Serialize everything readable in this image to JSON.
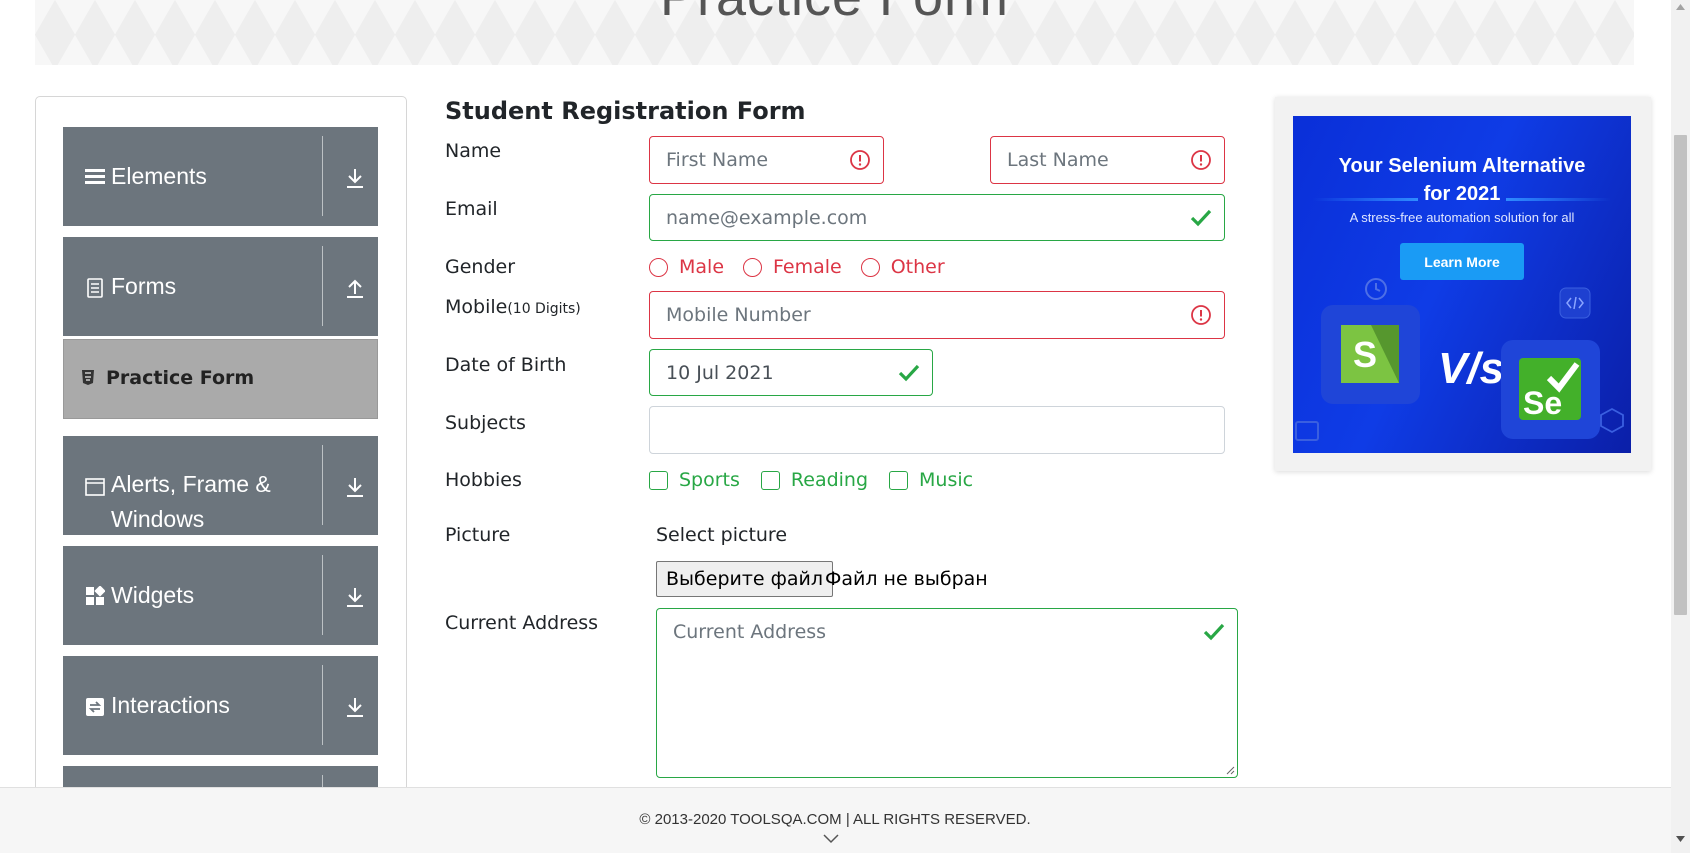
{
  "header": {
    "title": "Practice Form"
  },
  "sidebar": {
    "groups": [
      {
        "label": "Elements",
        "icon": "hamburger-icon",
        "arrow": "download-arrow-icon"
      },
      {
        "label": "Forms",
        "icon": "document-icon",
        "arrow": "upload-arrow-icon"
      },
      {
        "label": "Alerts, Frame & Windows",
        "icon": "window-icon",
        "arrow": "download-arrow-icon"
      },
      {
        "label": "Widgets",
        "icon": "widgets-icon",
        "arrow": "download-arrow-icon"
      },
      {
        "label": "Interactions",
        "icon": "interactions-icon",
        "arrow": "download-arrow-icon"
      }
    ],
    "active_item": {
      "label": "Practice Form",
      "icon": "html5-icon"
    }
  },
  "form": {
    "title": "Student Registration Form",
    "labels": {
      "name": "Name",
      "email": "Email",
      "gender": "Gender",
      "mobile": "Mobile",
      "mobile_hint": "(10 Digits)",
      "dob": "Date of Birth",
      "subjects": "Subjects",
      "hobbies": "Hobbies",
      "picture": "Picture",
      "address": "Current Address"
    },
    "first_name_placeholder": "First Name",
    "last_name_placeholder": "Last Name",
    "email_placeholder": "name@example.com",
    "mobile_placeholder": "Mobile Number",
    "dob_value": "10 Jul 2021",
    "subjects_value": "",
    "gender_options": [
      "Male",
      "Female",
      "Other"
    ],
    "hobby_options": [
      "Sports",
      "Reading",
      "Music"
    ],
    "picture_caption": "Select picture",
    "file_button_label": "Выберите файл",
    "file_status": "Файл не выбран",
    "address_placeholder": "Current Address",
    "colors": {
      "error": "#dc3545",
      "valid": "#28a745"
    }
  },
  "ad": {
    "title_line1": "Your Selenium Alternative",
    "title_line2": "for 2021",
    "subtitle": "A stress-free automation solution for all",
    "button": "Learn More",
    "vs": "V/s"
  },
  "footer": {
    "text": "© 2013-2020 TOOLSQA.COM | ALL RIGHTS RESERVED."
  }
}
